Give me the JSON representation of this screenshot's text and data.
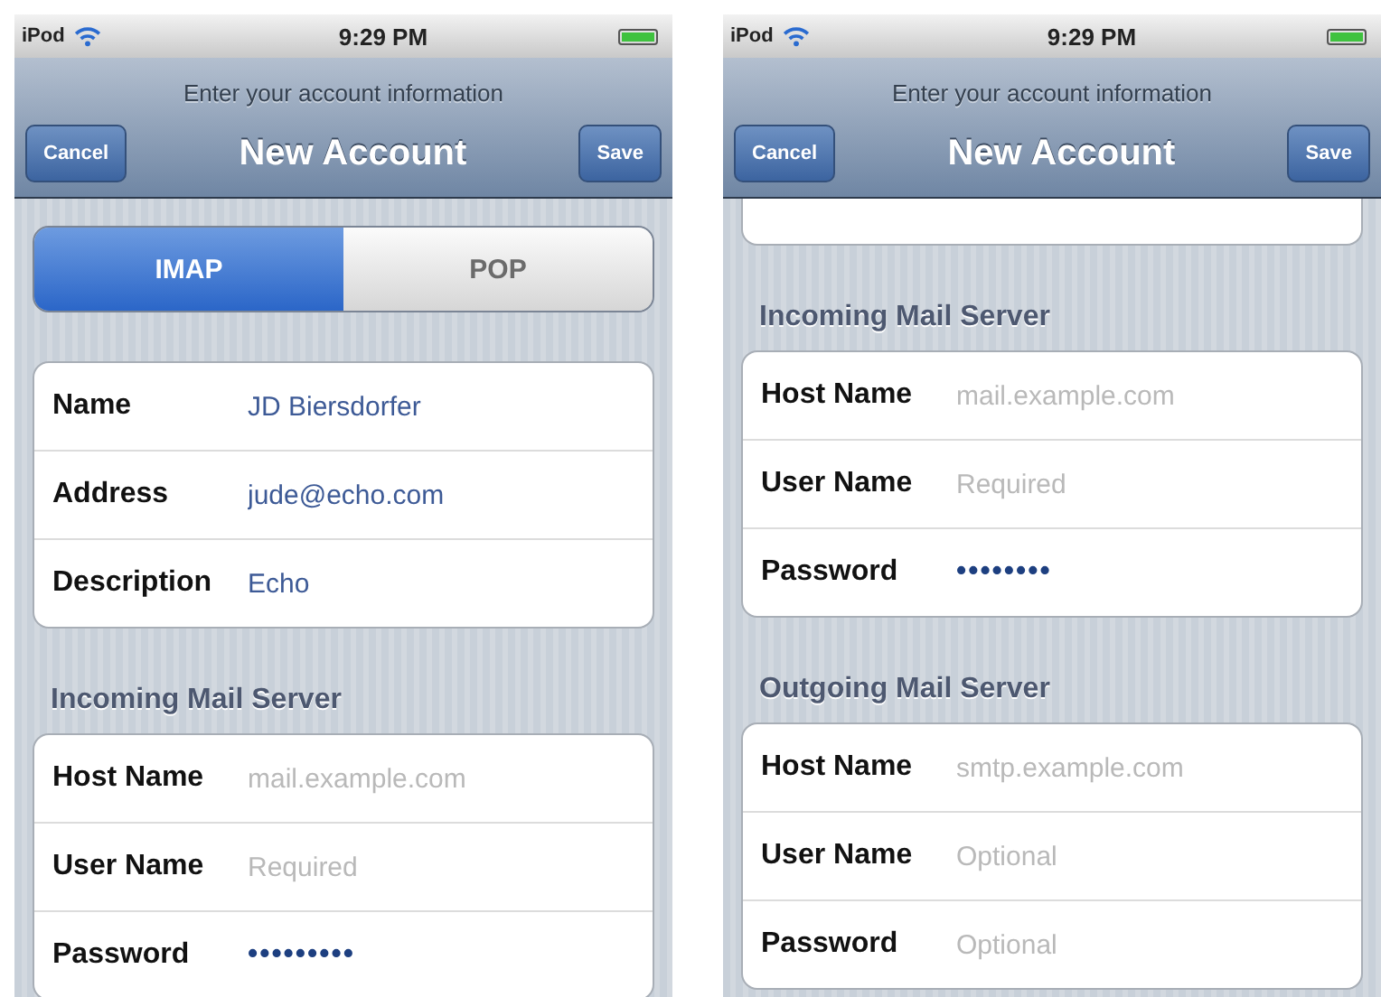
{
  "screens": [
    {
      "status_bar": {
        "carrier": "iPod",
        "time": "9:29 PM"
      },
      "prompt": "Enter your account information",
      "nav": {
        "left_button": "Cancel",
        "title": "New Account",
        "right_button": "Save"
      },
      "partial_card_above": false,
      "segments": [
        {
          "label": "IMAP",
          "selected": true
        },
        {
          "label": "POP",
          "selected": false
        }
      ],
      "sections": [
        {
          "rows": [
            {
              "label": "Name",
              "value": "JD Biersdorfer"
            },
            {
              "label": "Address",
              "value": "jude@echo.com"
            },
            {
              "label": "Description",
              "value": "Echo"
            }
          ]
        },
        {
          "header": "Incoming Mail Server",
          "rows": [
            {
              "label": "Host Name",
              "placeholder": "mail.example.com"
            },
            {
              "label": "User Name",
              "placeholder": "Required"
            },
            {
              "label": "Password",
              "value": "•••••••••",
              "kind": "password"
            }
          ]
        }
      ]
    },
    {
      "status_bar": {
        "carrier": "iPod",
        "time": "9:29 PM"
      },
      "prompt": "Enter your account information",
      "nav": {
        "left_button": "Cancel",
        "title": "New Account",
        "right_button": "Save"
      },
      "partial_card_above": true,
      "sections": [
        {
          "header": "Incoming Mail Server",
          "rows": [
            {
              "label": "Host Name",
              "placeholder": "mail.example.com"
            },
            {
              "label": "User Name",
              "placeholder": "Required"
            },
            {
              "label": "Password",
              "value": "••••••••",
              "kind": "password"
            }
          ]
        },
        {
          "header": "Outgoing Mail Server",
          "rows": [
            {
              "label": "Host Name",
              "placeholder": "smtp.example.com"
            },
            {
              "label": "User Name",
              "placeholder": "Optional"
            },
            {
              "label": "Password",
              "placeholder": "Optional",
              "kind": "password"
            }
          ]
        }
      ]
    }
  ]
}
